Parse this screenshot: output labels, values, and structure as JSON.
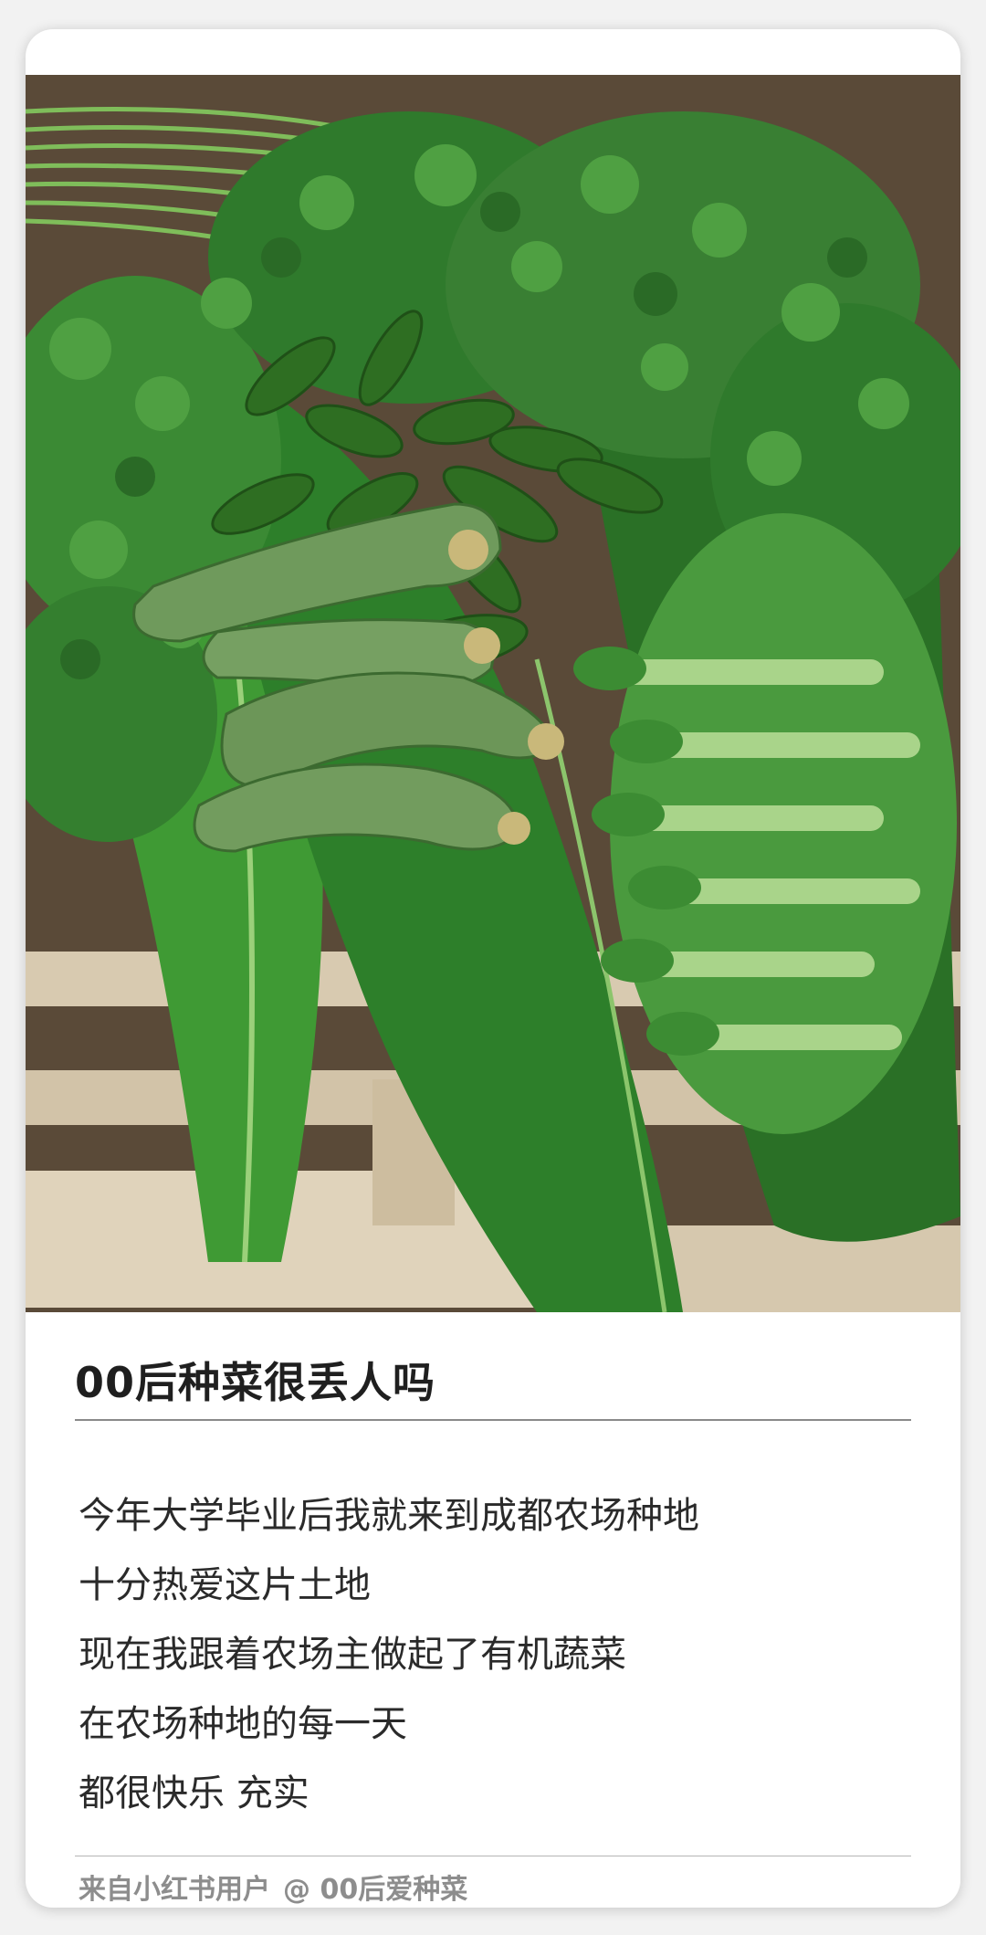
{
  "post": {
    "image_alt_icon": "vegetable-photo",
    "title": "00后种菜很丢人吗",
    "body_lines": [
      "今年大学毕业后我就来到成都农场种地",
      "十分热爱这片土地",
      "现在我跟着农场主做起了有机蔬菜",
      "在农场种地的每一天",
      "都很快乐 充实"
    ],
    "source_label": "来自小红书用户",
    "author_handle": "@ 00后爱种菜"
  },
  "colors": {
    "card_bg": "#ffffff",
    "page_bg": "#f2f2f2",
    "title_text": "#1f1f1f",
    "body_text": "#2a2a2a",
    "footer_text": "#8d8d8d",
    "leaf_green": "#2f7a2c",
    "banana_leaf": "#3f9a34",
    "pallet_wood": "#d9cbb2"
  }
}
